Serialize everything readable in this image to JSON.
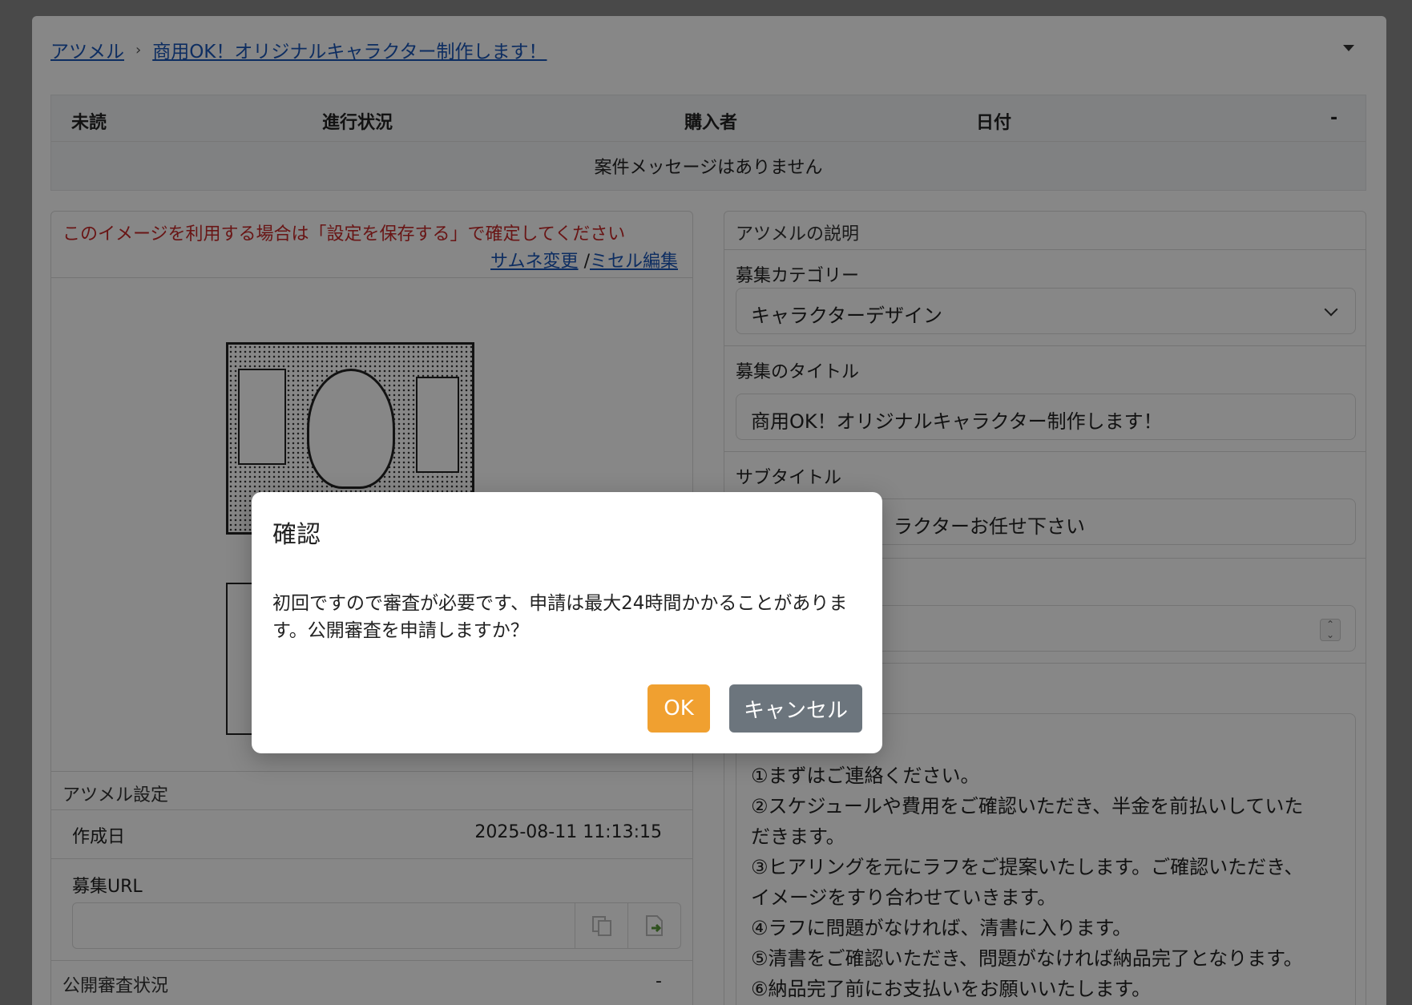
{
  "breadcrumb": {
    "home": "アツメル",
    "current": "商用OK！オリジナルキャラクター制作します！"
  },
  "messages": {
    "columns": [
      "未読",
      "進行状況",
      "購入者",
      "日付",
      "-"
    ],
    "empty_text": "案件メッセージはありません"
  },
  "image_panel": {
    "warning": "このイメージを利用する場合は「設定を保存する」で確定してください",
    "change_thumb": "サムネ変更",
    "separator": "/",
    "edit_misel": "ミセル編集"
  },
  "settings": {
    "title": "アツメル設定",
    "created_label": "作成日",
    "created_value": "2025-08-11 11:13:15",
    "url_label": "募集URL",
    "review_label": "公開審査状況",
    "review_value": "-"
  },
  "description": {
    "header": "アツメルの説明",
    "category_label": "募集カテゴリー",
    "category_value": "キャラクターデザイン",
    "title_label": "募集のタイトル",
    "title_value": "商用OK！オリジナルキャラクター制作します！",
    "subtitle_label": "サブタイトル",
    "subtitle_value": "ラクターお任せ下さい",
    "steps": [
      "①まずはご連絡ください。",
      "②スケジュールや費用をご確認いただき、半金を前払いしていた",
      "だきます。",
      "③ヒアリングを元にラフをご提案いたします。ご確認いただき、",
      "イメージをすり合わせていきます。",
      "④ラフに問題がなければ、清書に入ります。",
      "⑤清書をご確認いただき、問題がなければ納品完了となります。",
      "⑥納品完了前にお支払いをお願いいたします。"
    ]
  },
  "modal": {
    "title": "確認",
    "body": "初回ですので審査が必要です、申請は最大24時間かかることがあります。公開審査を申請しますか？",
    "ok": "OK",
    "cancel": "キャンセル"
  },
  "colors": {
    "link": "#1a56b8",
    "warning": "#c62828",
    "ok_button": "#f0a030",
    "cancel_button": "#6c757d"
  }
}
